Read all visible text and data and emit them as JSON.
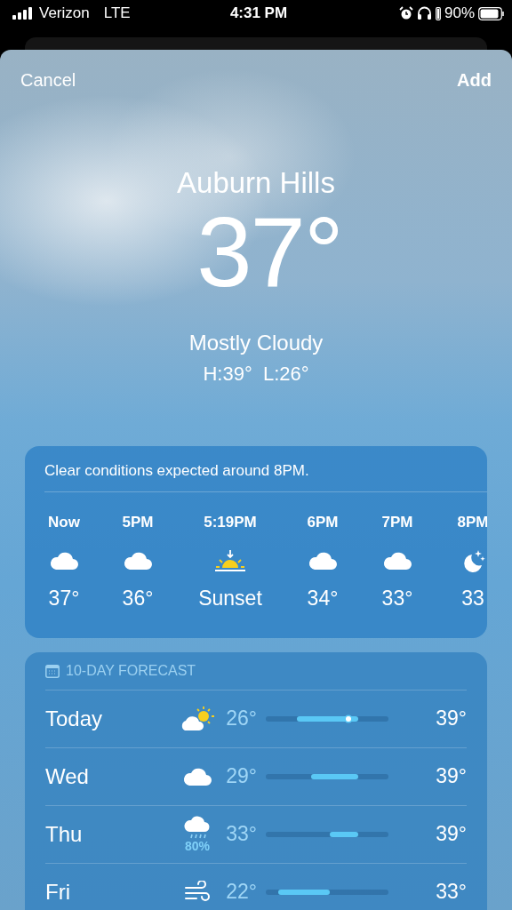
{
  "status_bar": {
    "carrier": "Verizon",
    "network": "LTE",
    "time": "4:31 PM",
    "battery": "90%"
  },
  "nav": {
    "cancel": "Cancel",
    "add": "Add"
  },
  "current": {
    "city": "Auburn Hills",
    "temperature": "37°",
    "condition": "Mostly Cloudy",
    "high_low": "H:39°  L:26°"
  },
  "hourly": {
    "summary": "Clear conditions expected around 8PM.",
    "items": [
      {
        "time": "Now",
        "kind": "cloud",
        "value": "37°"
      },
      {
        "time": "5PM",
        "kind": "cloud",
        "value": "36°"
      },
      {
        "time": "5:19PM",
        "kind": "sunset",
        "value": "Sunset"
      },
      {
        "time": "6PM",
        "kind": "cloud",
        "value": "34°"
      },
      {
        "time": "7PM",
        "kind": "cloud",
        "value": "33°"
      },
      {
        "time": "8PM",
        "kind": "moon",
        "value": "33"
      }
    ]
  },
  "daily": {
    "title": "10-DAY FORECAST",
    "rows": [
      {
        "day": "Today",
        "kind": "partly-sunny",
        "low": "26°",
        "high": "39°",
        "current": true
      },
      {
        "day": "Wed",
        "kind": "cloud",
        "low": "29°",
        "high": "39°",
        "current": false
      },
      {
        "day": "Thu",
        "kind": "rain",
        "precip": "80%",
        "low": "33°",
        "high": "39°",
        "current": false
      },
      {
        "day": "Fri",
        "kind": "wind",
        "low": "22°",
        "high": "33°",
        "current": false
      }
    ]
  }
}
